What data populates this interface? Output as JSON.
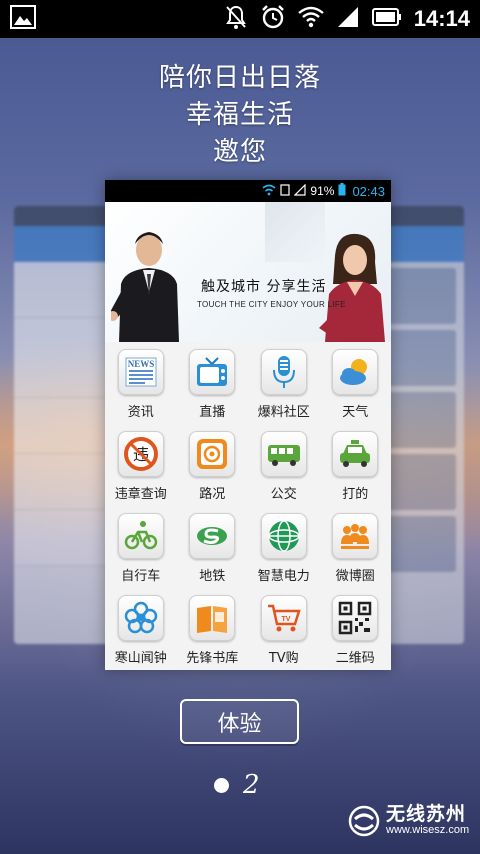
{
  "status_bar": {
    "time": "14:14",
    "icons": [
      "image-icon",
      "mute-icon",
      "alarm-icon",
      "wifi-icon",
      "signal-icon",
      "battery-icon"
    ]
  },
  "headline": {
    "lines": [
      "陪你日出日落",
      "幸福生活",
      "邀您"
    ]
  },
  "preview": {
    "status": {
      "battery_percent": "91%",
      "time": "02:43"
    },
    "banner": {
      "title": "触及城市   分享生活",
      "subtitle": "TOUCH THE CITY ENJOY YOUR LIFE"
    },
    "grid": [
      {
        "label": "资讯",
        "icon": "news-icon"
      },
      {
        "label": "直播",
        "icon": "tv-icon"
      },
      {
        "label": "爆料社区",
        "icon": "microphone-icon"
      },
      {
        "label": "天气",
        "icon": "weather-icon"
      },
      {
        "label": "违章查询",
        "icon": "violation-icon"
      },
      {
        "label": "路况",
        "icon": "traffic-icon"
      },
      {
        "label": "公交",
        "icon": "bus-icon"
      },
      {
        "label": "打的",
        "icon": "taxi-icon"
      },
      {
        "label": "自行车",
        "icon": "bicycle-icon"
      },
      {
        "label": "地铁",
        "icon": "subway-icon"
      },
      {
        "label": "智慧电力",
        "icon": "power-grid-icon"
      },
      {
        "label": "微博圈",
        "icon": "weibo-people-icon"
      },
      {
        "label": "寒山闻钟",
        "icon": "bell-flower-icon"
      },
      {
        "label": "先锋书库",
        "icon": "book-icon"
      },
      {
        "label": "TV购",
        "icon": "shopping-cart-icon"
      },
      {
        "label": "二维码",
        "icon": "qr-code-icon"
      }
    ]
  },
  "button": {
    "label": "体验"
  },
  "pager": {
    "current": "2",
    "total_dots": 1
  },
  "logo": {
    "name": "无线苏州",
    "url": "www.wisesz.com"
  },
  "colors": {
    "status_bar": "#000000",
    "preview_accent": "#2ab3f0",
    "text": "#ffffff"
  }
}
